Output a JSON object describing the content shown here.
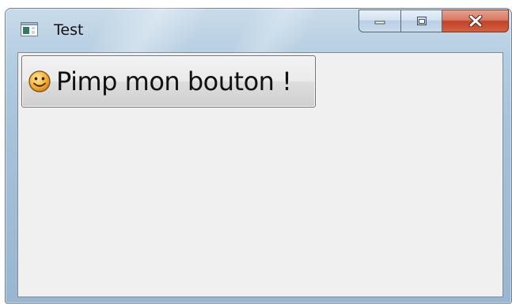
{
  "window": {
    "title": "Test",
    "controls": {
      "minimize_icon": "minimize-icon",
      "maximize_icon": "maximize-icon",
      "close_icon": "close-icon",
      "close_color": "#c4422a"
    }
  },
  "client": {
    "button": {
      "label": "Pimp mon bouton !",
      "icon": "smiley-icon"
    }
  }
}
